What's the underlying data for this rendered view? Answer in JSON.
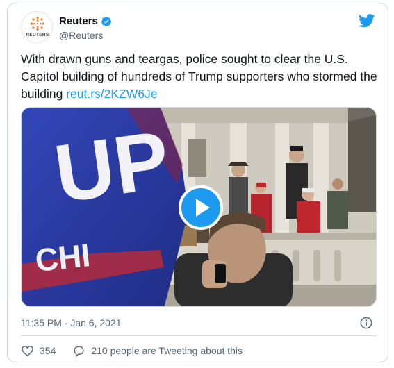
{
  "author": {
    "display_name": "Reuters",
    "handle": "@Reuters",
    "avatar_text": "REUTERS",
    "verified": true
  },
  "tweet": {
    "text": "With drawn guns and teargas, police sought to clear the U.S. Capitol building of hundreds of Trump supporters who stormed the building",
    "link_text": "reut.rs/2KZW6Je"
  },
  "media": {
    "type": "video",
    "flag_letters": "UP",
    "flag_lower_text": "CHI"
  },
  "meta": {
    "timestamp": "11:35 PM · Jan 6, 2021"
  },
  "actions": {
    "likes": "354",
    "conversation": "210 people are Tweeting about this"
  },
  "colors": {
    "accent": "#1d9bf0",
    "flag_blue": "#2b3ea8",
    "text_secondary": "#536471"
  },
  "icons": [
    "reuters-logo",
    "verified-badge-icon",
    "twitter-bird-icon",
    "play-icon",
    "info-icon",
    "heart-icon",
    "speech-bubble-icon"
  ]
}
